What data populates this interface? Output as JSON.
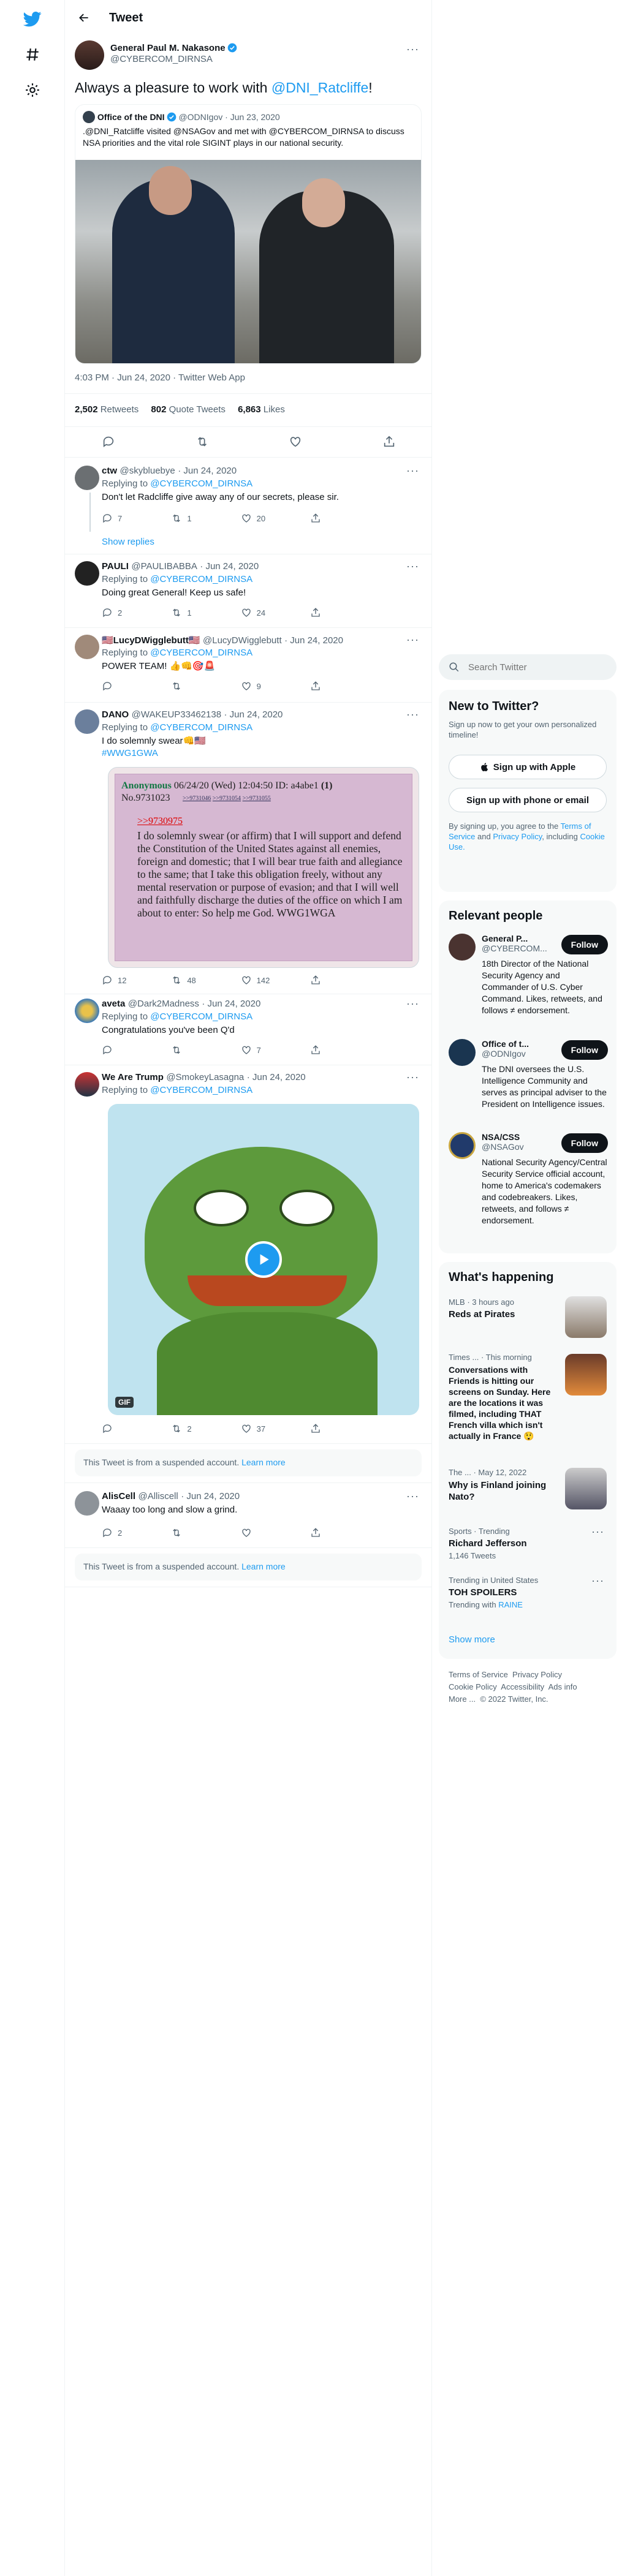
{
  "nav": {
    "home": "twitter-logo",
    "explore": "hashtag-icon",
    "settings": "gear-icon"
  },
  "header": {
    "title": "Tweet"
  },
  "tweet": {
    "name": "General Paul M. Nakasone",
    "handle": "@CYBERCOM_DIRNSA",
    "text": "Always a pleasure to work with @DNI_Ratcliffe!",
    "quote": {
      "name": "Office of the DNI",
      "handle": "@ODNIgov",
      "date": "· Jun 23, 2020",
      "text": ".@DNI_Ratcliffe visited @NSAGov and met with @CYBERCOM_DIRNSA to discuss NSA priorities and the vital role SIGINT plays in our national security."
    },
    "meta": "4:03 PM · Jun 24, 2020 · Twitter Web App",
    "retweets_n": "2,502",
    "retweets_l": "Retweets",
    "quotes_n": "802",
    "quotes_l": "Quote Tweets",
    "likes_n": "6,863",
    "likes_l": "Likes"
  },
  "replies": [
    {
      "name": "ctw",
      "handle": "@skybluebye",
      "date": "· Jun 24, 2020",
      "replying": "Replying to",
      "to": "@CYBERCOM_DIRNSA",
      "text": "Don't let Radcliffe give away any of our secrets, please sir.",
      "reply": "7",
      "rt": "1",
      "like": "20",
      "show": "Show replies"
    },
    {
      "name": "PAULI",
      "handle": "@PAULIBABBA",
      "date": "· Jun 24, 2020",
      "replying": "Replying to",
      "to": "@CYBERCOM_DIRNSA",
      "text": "Doing great General! Keep us safe!",
      "reply": "2",
      "rt": "1",
      "like": "24"
    },
    {
      "name": "🇺🇸LucyDWigglebutt🇺🇸",
      "handle": "@LucyDWigglebutt",
      "date": "· Jun 24, 2020",
      "replying": "Replying to",
      "to": "@CYBERCOM_DIRNSA",
      "text": "POWER TEAM! 👍👊🎯🚨",
      "reply": "",
      "rt": "",
      "like": "9"
    },
    {
      "name": "DANO",
      "handle": "@WAKEUP33462138",
      "date": "· Jun 24, 2020",
      "replying": "Replying to",
      "to": "@CYBERCOM_DIRNSA",
      "text": "I do solemnly swear👊🇺🇸",
      "tag": "#WWG1GWA",
      "reply": "12",
      "rt": "48",
      "like": "142"
    },
    {
      "name": "aveta",
      "handle": "@Dark2Madness",
      "date": "· Jun 24, 2020",
      "replying": "Replying to",
      "to": "@CYBERCOM_DIRNSA",
      "text": "Congratulations you've been Q'd",
      "reply": "",
      "rt": "",
      "like": "7"
    },
    {
      "name": "We Are Trump",
      "handle": "@SmokeyLasagna",
      "date": "· Jun 24, 2020",
      "replying": "Replying to",
      "to": "@CYBERCOM_DIRNSA",
      "reply": "",
      "rt": "2",
      "like": "37",
      "gif": "GIF"
    },
    {
      "name": "AlisCell",
      "handle": "@Alliscell",
      "date": "· Jun 24, 2020",
      "text": "Waaay too long and slow a grind.",
      "reply": "2",
      "rt": "",
      "like": ""
    }
  ],
  "qpost": {
    "head": "Anonymous",
    "meta": "06/24/20 (Wed) 12:04:50 ID: a4abe1",
    "count": "(1)",
    "no": "No.9731023",
    "links": [
      ">>9731046",
      ">>9731054",
      ">>9731055"
    ],
    "quote": ">>9730975",
    "body": "I do solemnly swear (or affirm) that I will support and defend the Constitution of the United States against all enemies, foreign and domestic; that I will bear true faith and allegiance to the same; that I take this obligation freely, without any mental reservation or purpose of evasion; and that I will well and faithfully discharge the duties of the office on which I am about to enter: So help me God. WWG1WGA"
  },
  "suspended": {
    "text": "This Tweet is from a suspended account.",
    "link": "Learn more"
  },
  "search": {
    "placeholder": "Search Twitter"
  },
  "new_to": {
    "title": "New to Twitter?",
    "sub": "Sign up now to get your own personalized timeline!",
    "apple": "Sign up with Apple",
    "phone": "Sign up with phone or email",
    "legal_pre": "By signing up, you agree to the",
    "tos": "Terms of Service",
    "and": "and",
    "privacy": "Privacy Policy",
    "incl": ", including",
    "cookie": "Cookie Use."
  },
  "relevant": {
    "title": "Relevant people",
    "follow": "Follow",
    "people": [
      {
        "name": "General P...",
        "handle": "@CYBERCOM...",
        "bio": "18th Director of the National Security Agency and Commander of U.S. Cyber Command. Likes, retweets, and follows ≠ endorsement."
      },
      {
        "name": "Office of t...",
        "handle": "@ODNIgov",
        "bio": "The DNI oversees the U.S. Intelligence Community and serves as principal adviser to the President on Intelligence issues."
      },
      {
        "name": "NSA/CSS",
        "handle": "@NSAGov",
        "bio": "National Security Agency/Central Security Service official account, home to America's codemakers and codebreakers. Likes, retweets, and follows ≠ endorsement."
      }
    ]
  },
  "happening": {
    "title": "What's happening",
    "items": [
      {
        "meta": "MLB · 3 hours ago",
        "title": "Reds at Pirates"
      },
      {
        "meta": "Times ... · This morning",
        "title": "Conversations with Friends is hitting our screens on Sunday. Here are the locations it was filmed, including THAT French villa which isn't actually in France 😲"
      },
      {
        "meta": "The ... · May 12, 2022",
        "title": "Why is Finland joining Nato?"
      },
      {
        "meta": "Sports · Trending",
        "title": "Richard Jefferson",
        "sub": "1,146 Tweets"
      },
      {
        "meta": "Trending in United States",
        "title": "TOH SPOILERS",
        "sub_pre": "Trending with",
        "sub_link": "RAINE"
      }
    ],
    "more": "Show more"
  },
  "footer": [
    "Terms of Service",
    "Privacy Policy",
    "Cookie Policy",
    "Accessibility",
    "Ads info",
    "More ...",
    "© 2022 Twitter, Inc."
  ]
}
